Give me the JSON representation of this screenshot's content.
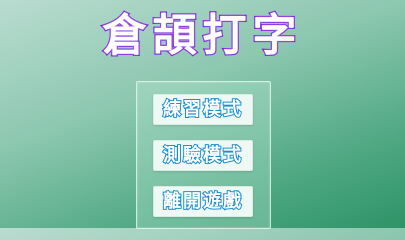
{
  "title": "倉頡打字",
  "menu": {
    "practice_label": "練習模式",
    "test_label": "測驗模式",
    "exit_label": "離開遊戲"
  },
  "colors": {
    "title_outline": "#7a1ad6",
    "button_text_outline": "#1a8fd0",
    "background_top": "#b9dcd0",
    "background_bottom": "#2e9367"
  }
}
